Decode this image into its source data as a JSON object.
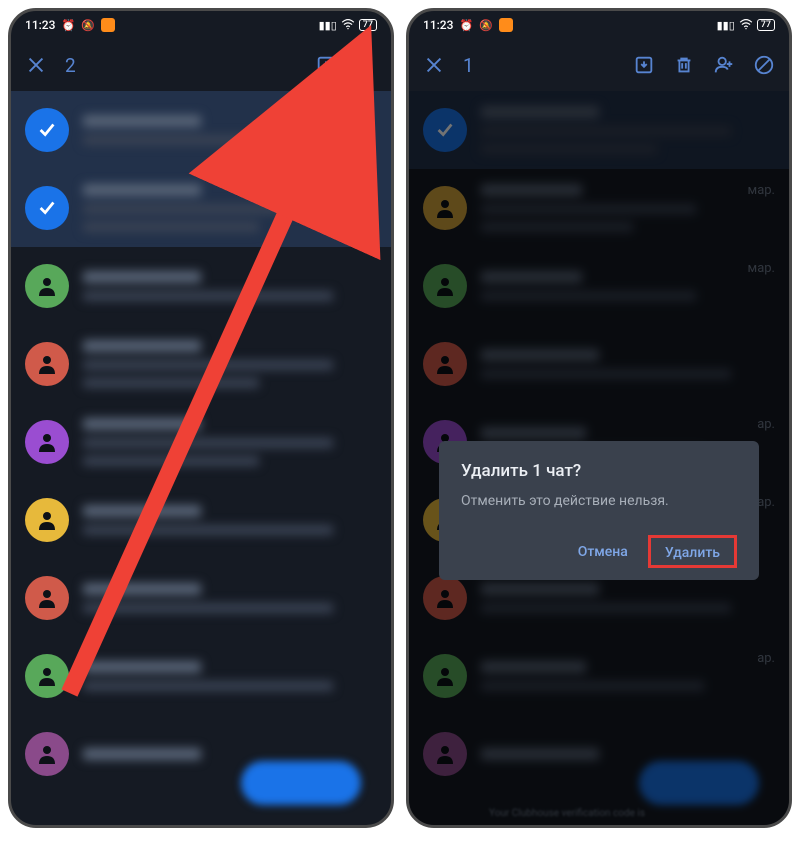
{
  "status": {
    "time": "11:23",
    "battery": "77"
  },
  "left": {
    "selection_count": "2",
    "avatar_colors": [
      "#58a85a",
      "#d05a4a",
      "#9a4dd1",
      "#e7b93b",
      "#d05a4a",
      "#58a85a",
      "#8a4a8a"
    ]
  },
  "right": {
    "selection_count": "1",
    "dialog": {
      "title": "Удалить 1 чат?",
      "message": "Отменить это действие нельзя.",
      "cancel": "Отмена",
      "confirm": "Удалить"
    },
    "dates": [
      "мар.",
      "мар.",
      "ар.",
      "ар.",
      "ар."
    ],
    "avatar_colors": [
      "#d1a33b",
      "#d05a4a",
      "#9a4dd1",
      "#e7b93b",
      "#d05a4a",
      "#58a85a",
      "#8a4a8a"
    ],
    "bottom_hint": "Your Clubhouse verification code is"
  }
}
